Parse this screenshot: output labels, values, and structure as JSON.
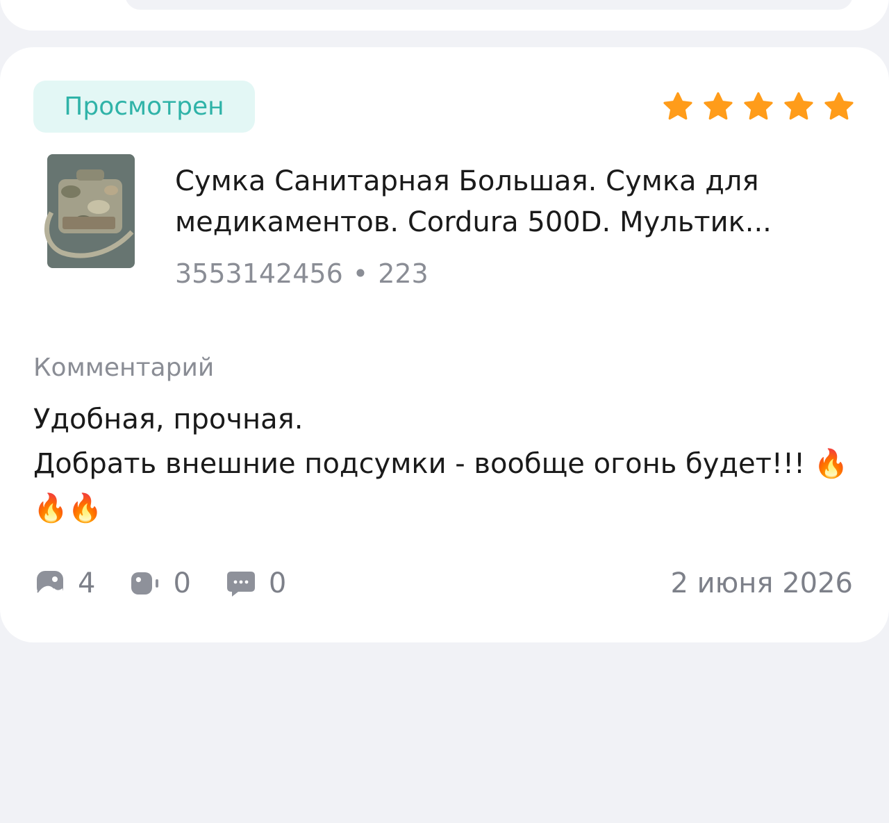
{
  "review": {
    "status": "Просмотрен",
    "rating": 5,
    "product": {
      "title": "Сумка Санитарная Большая. Сумка для медикаментов. Cordura 500D. Мультик...",
      "article": "3553142456",
      "separator": "•",
      "size": "223"
    },
    "comment_label": "Комментарий",
    "comment_text": "Удобная, прочная.\nДобрать внешние подсумки - вообще огонь будет!!! 🔥🔥🔥",
    "stats": {
      "photos": "4",
      "videos": "0",
      "comments": "0"
    },
    "date": "2 июня 2026"
  },
  "colors": {
    "status_bg": "#e3f7f5",
    "status_text": "#2fb3a8",
    "star": "#ff9c1a",
    "muted": "#8a8d95"
  },
  "icons": [
    "star-icon",
    "photo-icon",
    "video-icon",
    "comment-icon"
  ]
}
